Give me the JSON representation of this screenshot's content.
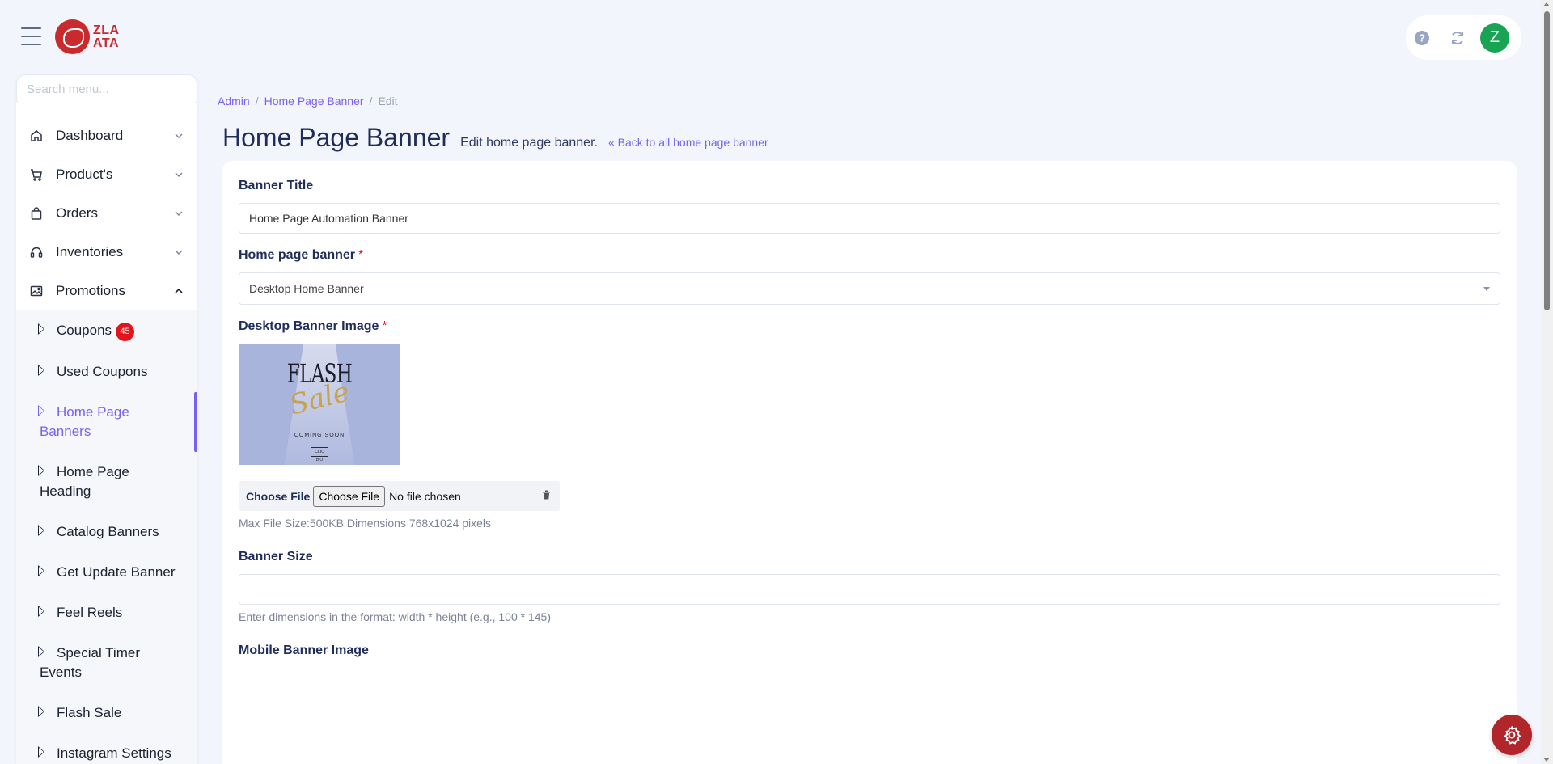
{
  "brand": {
    "logo_line1": "ZLA",
    "logo_line2": "ATA",
    "accent_color": "#7a5ff0",
    "brand_color": "#c92a2e"
  },
  "header": {
    "avatar_initial": "Z",
    "icons": [
      "menu-icon",
      "help-icon",
      "refresh-icon"
    ]
  },
  "sidebar": {
    "search_placeholder": "Search menu...",
    "items": [
      {
        "label": "Dashboard",
        "icon": "home-icon"
      },
      {
        "label": "Product's",
        "icon": "cart-icon"
      },
      {
        "label": "Orders",
        "icon": "bag-icon"
      },
      {
        "label": "Inventories",
        "icon": "headset-icon"
      },
      {
        "label": "Promotions",
        "icon": "image-icon"
      }
    ],
    "promotions_sub": [
      {
        "label": "Coupons",
        "badge": "45"
      },
      {
        "label": "Used Coupons"
      },
      {
        "label": "Home Page Banners"
      },
      {
        "label": "Home Page Heading"
      },
      {
        "label": "Catalog Banners"
      },
      {
        "label": "Get Update Banner"
      },
      {
        "label": "Feel Reels"
      },
      {
        "label": "Special Timer Events"
      },
      {
        "label": "Flash Sale"
      },
      {
        "label": "Instagram Settings"
      }
    ]
  },
  "breadcrumb": {
    "items": [
      "Admin",
      "Home Page Banner",
      "Edit"
    ],
    "separator": "/"
  },
  "page": {
    "title": "Home Page Banner",
    "subtitle": "Edit home page banner.",
    "back_link": "« Back to all home page banner"
  },
  "form": {
    "banner_title": {
      "label": "Banner Title",
      "value": "Home Page Automation Banner"
    },
    "home_page_banner": {
      "label": "Home page banner",
      "required_mark": "*",
      "selected": "Desktop Home Banner"
    },
    "desktop_image": {
      "label": "Desktop Banner Image",
      "required_mark": "*",
      "preview": {
        "headline": "FLASH",
        "script": "Sale",
        "tagline": "COMING SOON",
        "tag": "CLIC BIO"
      },
      "file_label": "Choose File",
      "file_button": "Choose File",
      "file_status": "No file chosen",
      "hint": "Max File Size:500KB Dimensions 768x1024 pixels"
    },
    "banner_size": {
      "label": "Banner Size",
      "value": "",
      "hint": "Enter dimensions in the format: width * height (e.g., 100 * 145)"
    },
    "mobile_image": {
      "label": "Mobile Banner Image"
    }
  }
}
